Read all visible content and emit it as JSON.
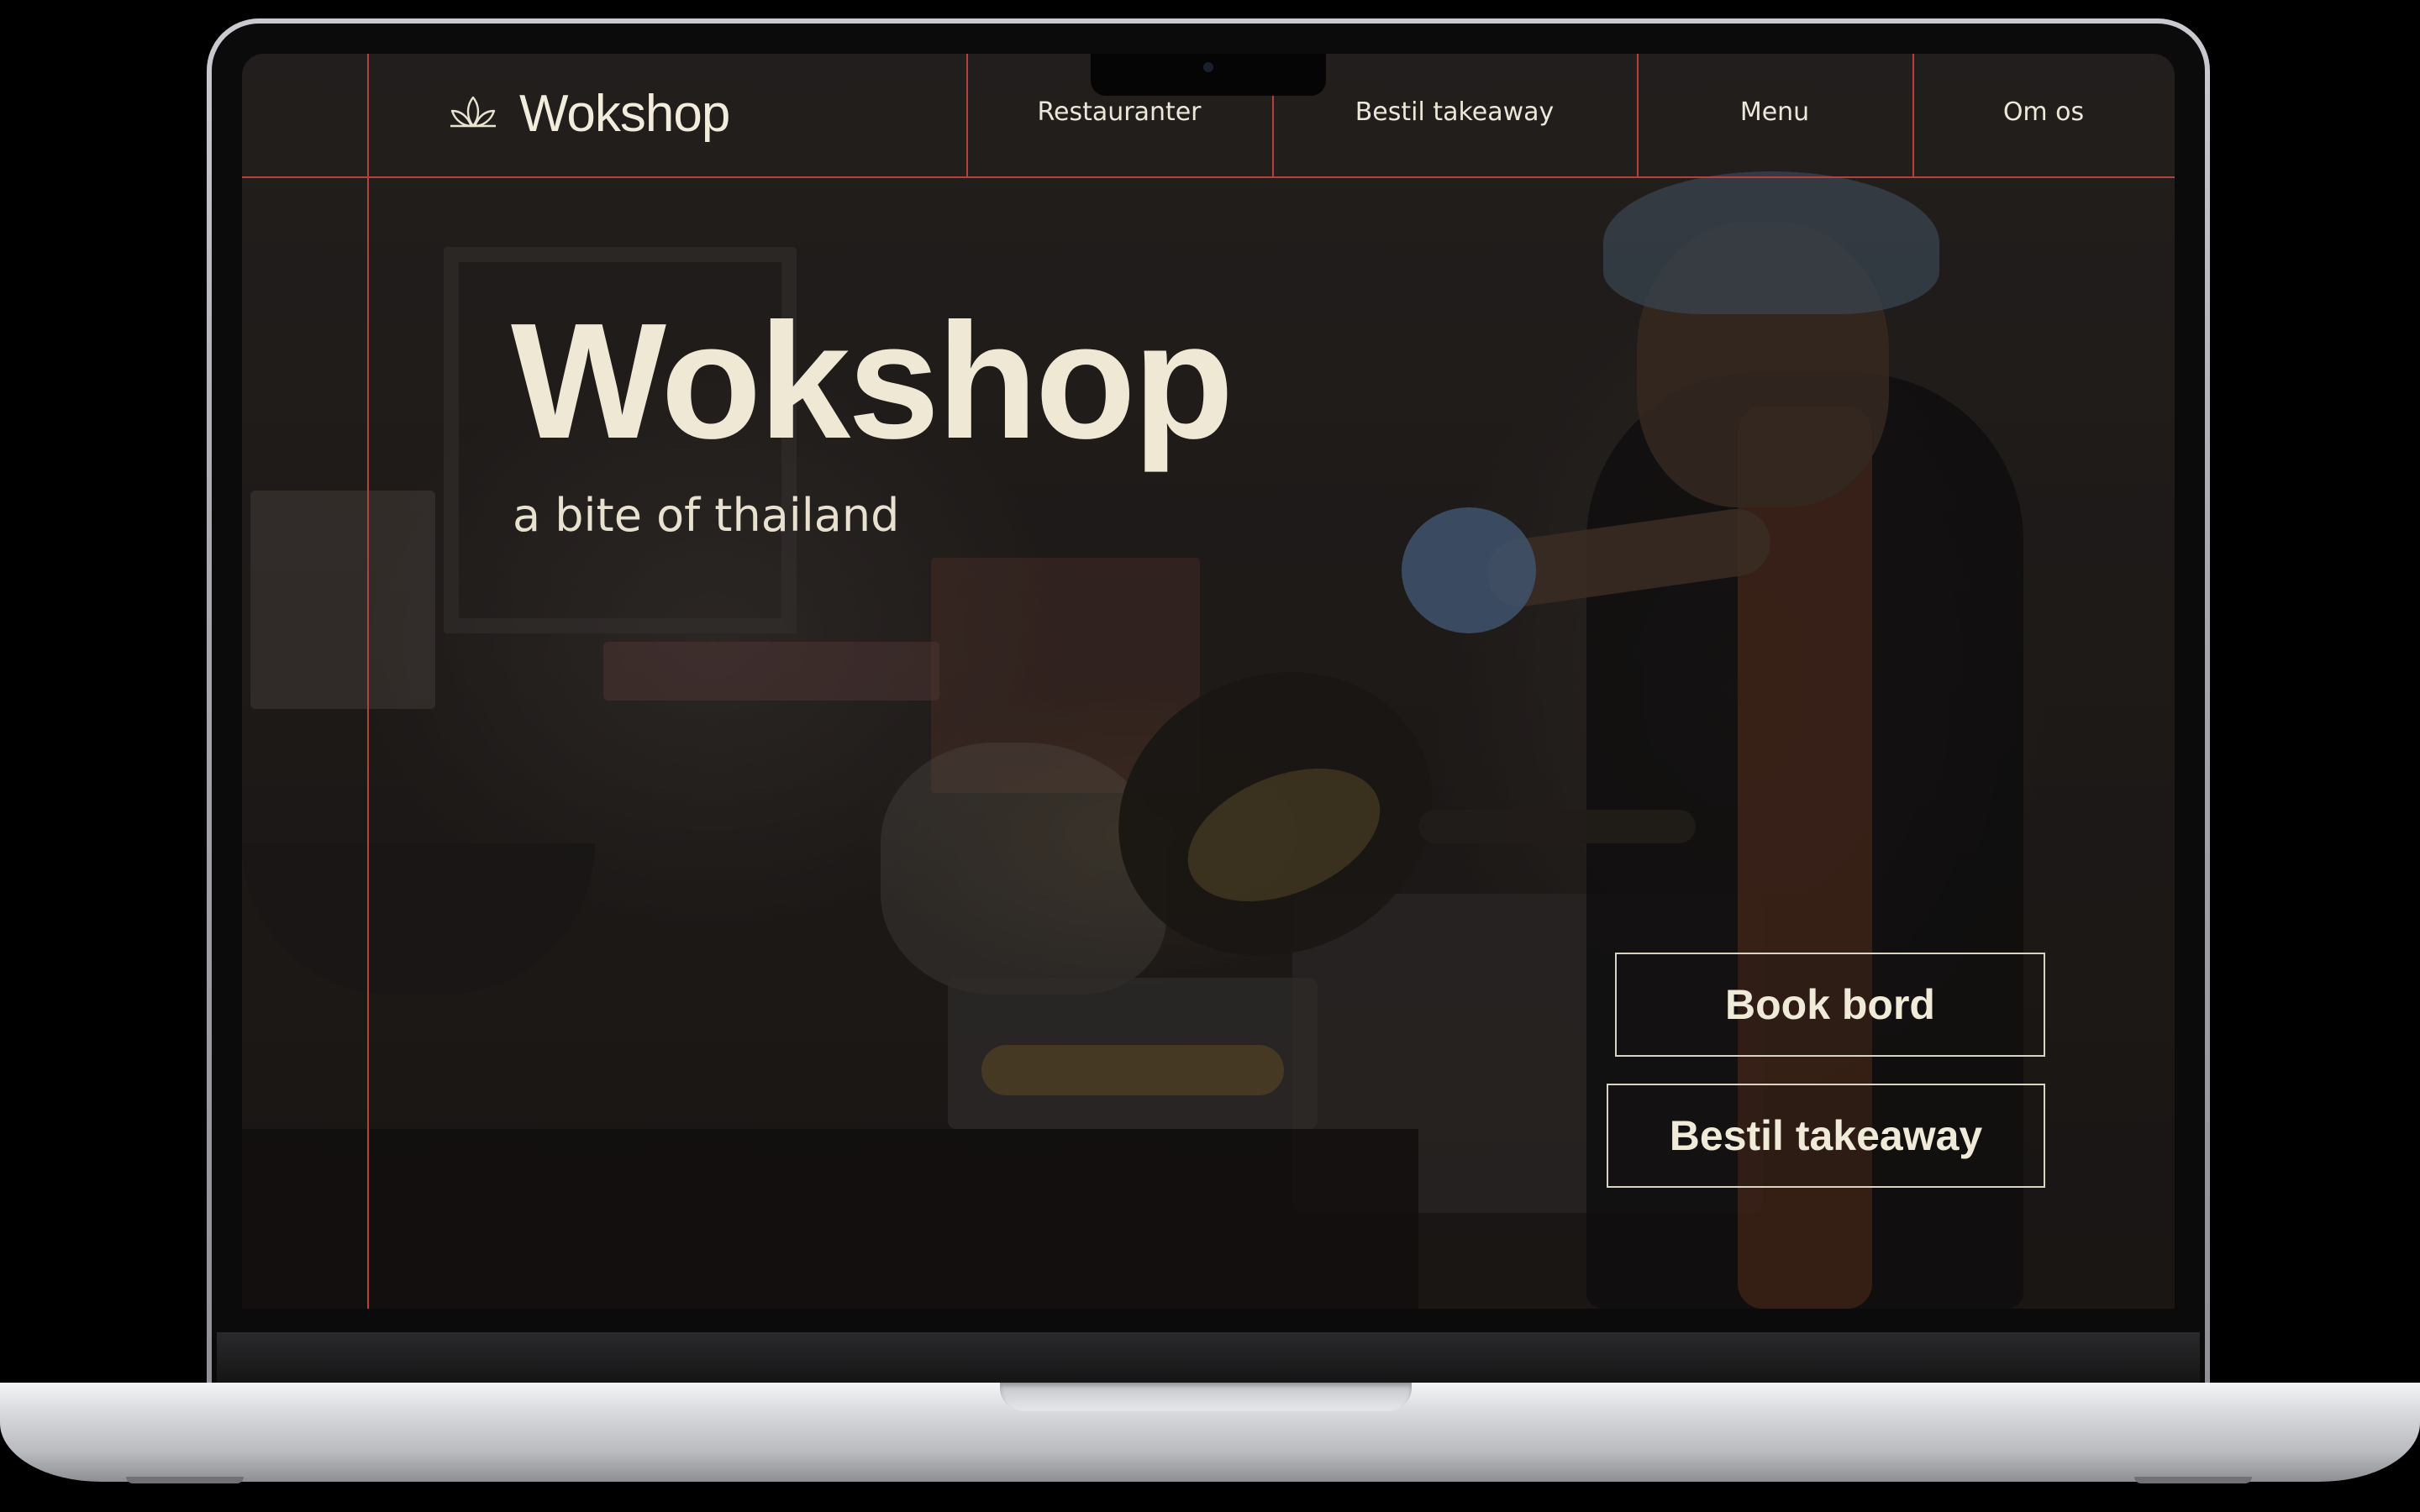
{
  "nav": {
    "logo_text": "Wokshop",
    "links": [
      {
        "label": "Restauranter"
      },
      {
        "label": "Bestil takeaway"
      },
      {
        "label": "Menu"
      },
      {
        "label": "Om os"
      }
    ]
  },
  "hero": {
    "title": "Wokshop",
    "subtitle": "a bite of thailand"
  },
  "cta": {
    "book_label": "Book bord",
    "takeaway_label": "Bestil takeaway"
  },
  "icons": {
    "logo": "lotus-icon"
  },
  "colors": {
    "accent_lines": "#b8403a",
    "text_cream": "#efe8d5",
    "background": "#1d1a19"
  }
}
